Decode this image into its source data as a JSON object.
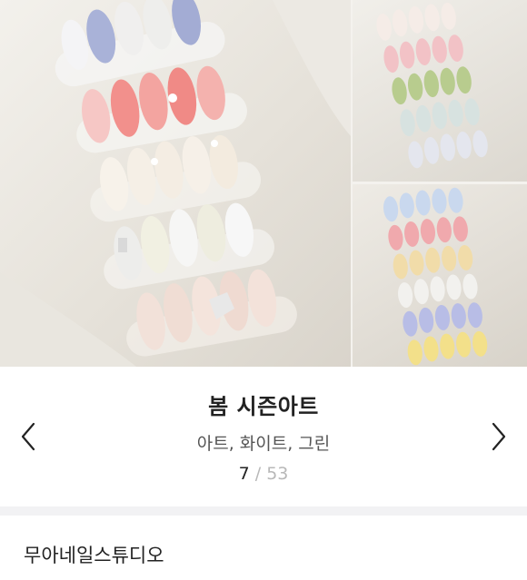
{
  "gallery": {
    "title": "봄 시즌아트",
    "tags": "아트, 화이트, 그린",
    "counter": {
      "current": "7",
      "separator": "/",
      "total": "53"
    }
  },
  "navigation": {
    "prev_icon": "chevron-left-icon",
    "next_icon": "chevron-right-icon"
  },
  "shop": {
    "name": "무아네일스튜디오"
  },
  "colors": {
    "text": "#222222",
    "muted": "#b8b8b8",
    "divider": "#f2f2f4"
  }
}
